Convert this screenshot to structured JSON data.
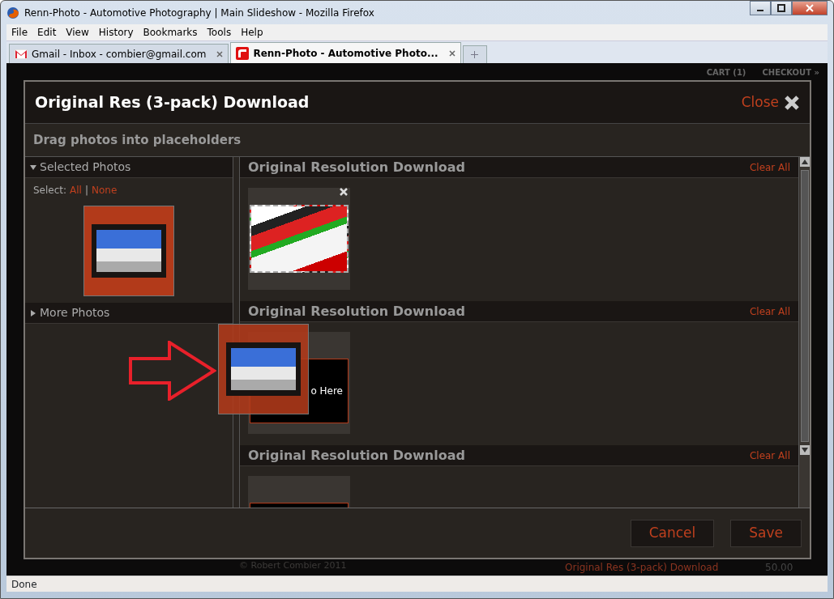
{
  "window": {
    "title": "Renn-Photo - Automotive Photography | Main Slideshow - Mozilla Firefox"
  },
  "menu": [
    "File",
    "Edit",
    "View",
    "History",
    "Bookmarks",
    "Tools",
    "Help"
  ],
  "tabs": [
    {
      "label": "Gmail - Inbox - combier@gmail.com",
      "selected": false,
      "kind": "gmail"
    },
    {
      "label": "Renn-Photo - Automotive Photo...",
      "selected": true,
      "kind": "renn"
    }
  ],
  "page": {
    "cart": "CART (1)",
    "checkout": "CHECKOUT »",
    "copyright": "© Robert Combier 2011",
    "cart_item": "Original Res (3-pack) Download",
    "price": "50.00"
  },
  "dialog": {
    "title": "Original Res (3-pack) Download",
    "close": "Close",
    "instruction": "Drag photos into placeholders",
    "sections": [
      {
        "title": "Selected Photos",
        "expanded": true,
        "select_label": "Select:",
        "select_links": [
          "All",
          "None"
        ],
        "separator": "|"
      },
      {
        "title": "More Photos",
        "expanded": false
      }
    ],
    "slots": [
      {
        "title": "Original Resolution Download",
        "clear": "Clear All",
        "kind": "filled"
      },
      {
        "title": "Original Resolution Download",
        "clear": "Clear All",
        "kind": "empty",
        "placeholder": "o Here"
      },
      {
        "title": "Original Resolution Download",
        "clear": "Clear All",
        "kind": "empty"
      }
    ],
    "buttons": [
      "Cancel",
      "Save"
    ]
  },
  "status_bar": "Done"
}
